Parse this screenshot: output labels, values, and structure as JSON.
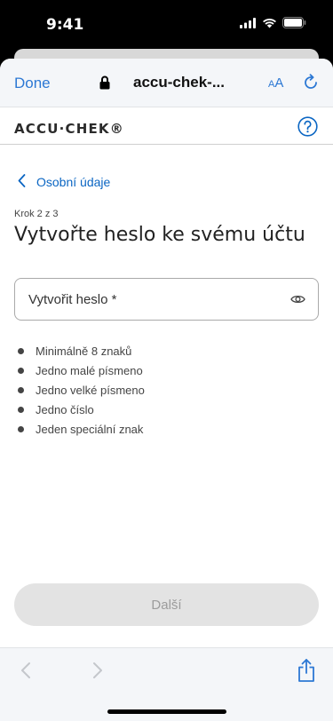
{
  "status_bar": {
    "time": "9:41"
  },
  "browser": {
    "done_label": "Done",
    "url": "accu-chek-...",
    "aa_small": "A",
    "aa_large": "A"
  },
  "site": {
    "logo": "ACCU·CHEK®"
  },
  "page": {
    "back_label": "Osobní údaje",
    "step": "Krok 2 z 3",
    "title": "Vytvořte heslo ke svému účtu",
    "password_field": {
      "label": "Vytvořit heslo *"
    },
    "requirements": [
      "Minimálně 8 znaků",
      "Jedno malé písmeno",
      "Jedno velké písmeno",
      "Jedno číslo",
      "Jeden speciální znak"
    ],
    "next_label": "Další"
  },
  "colors": {
    "link": "#0b66c3",
    "ios_blue": "#2c78d4",
    "disabled_bg": "#e3e3e3",
    "disabled_text": "#9c9c9c"
  }
}
